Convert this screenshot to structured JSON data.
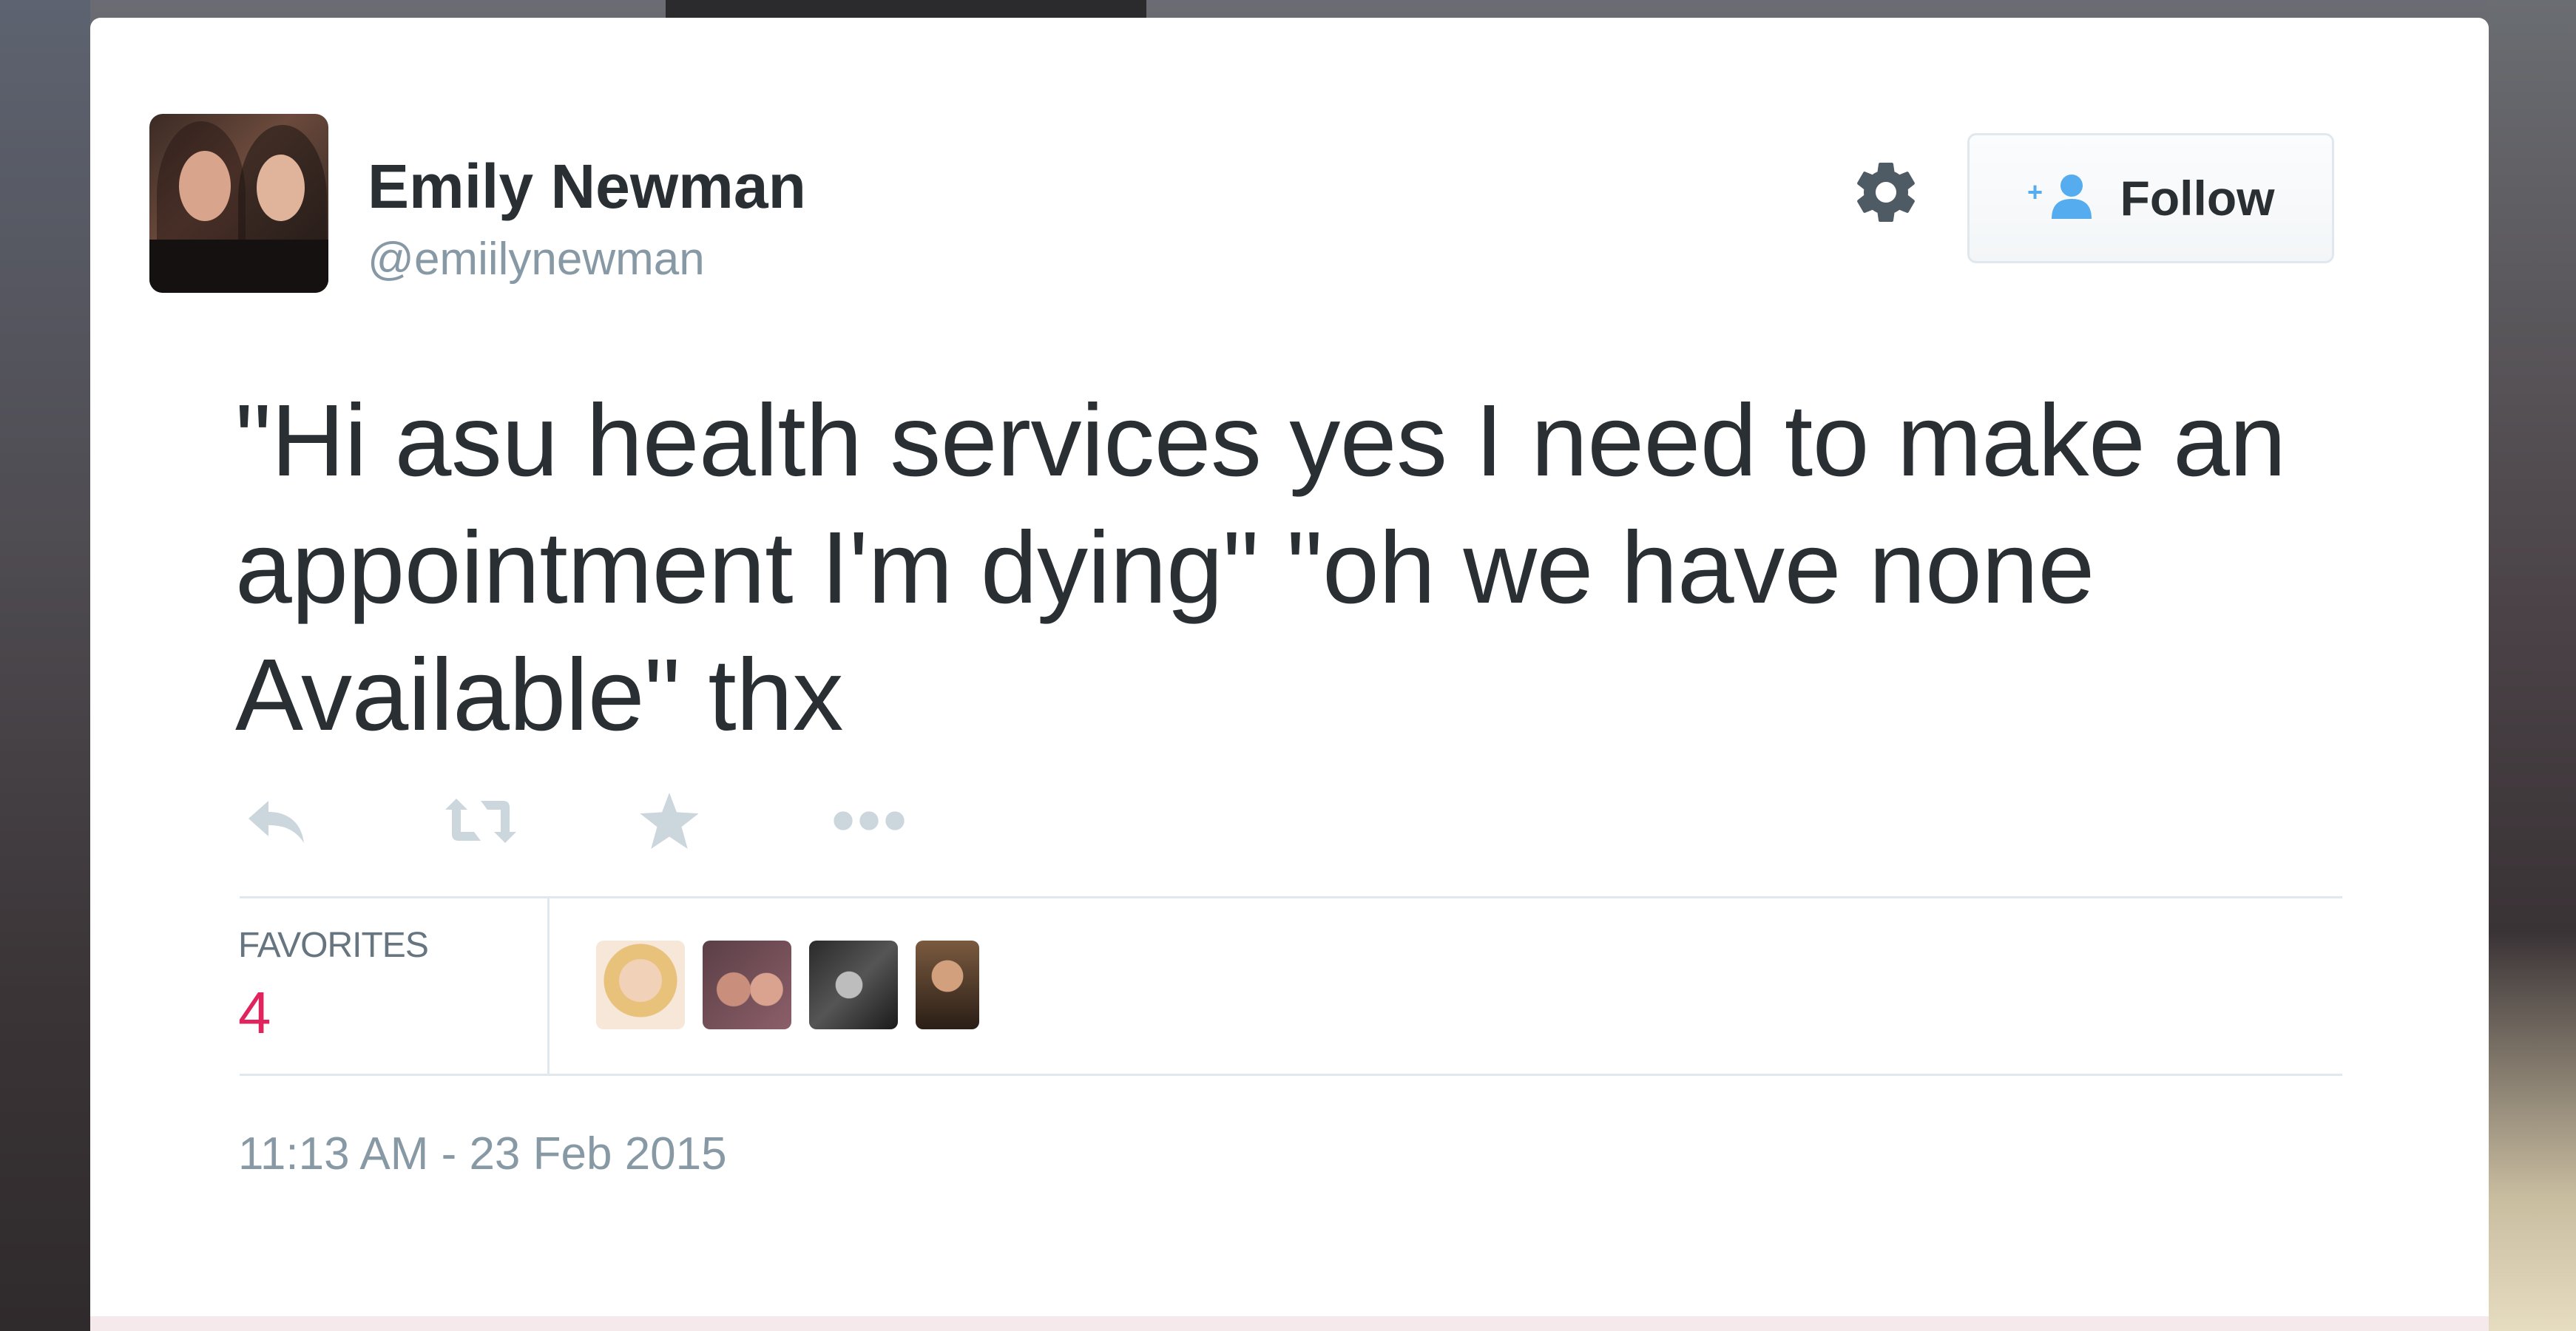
{
  "user": {
    "display_name": "Emily Newman",
    "handle": "@emiilynewman"
  },
  "header": {
    "follow_label": "Follow"
  },
  "tweet": {
    "text": "\"Hi asu health services yes I need to make an appointment I'm dying\" \"oh we have none Available\" thx",
    "timestamp": "11:13 AM - 23 Feb 2015"
  },
  "actions": [
    "reply-icon",
    "retweet-icon",
    "favorite-star-icon",
    "more-dots-icon"
  ],
  "stats": {
    "favorites_label": "FAVORITES",
    "favorites_count": "4"
  },
  "colors": {
    "text_primary": "#292f33",
    "text_secondary": "#8899a6",
    "favorites_count": "#e0245e",
    "follow_icon": "#55acee",
    "action_icon": "#ccd6dd"
  }
}
